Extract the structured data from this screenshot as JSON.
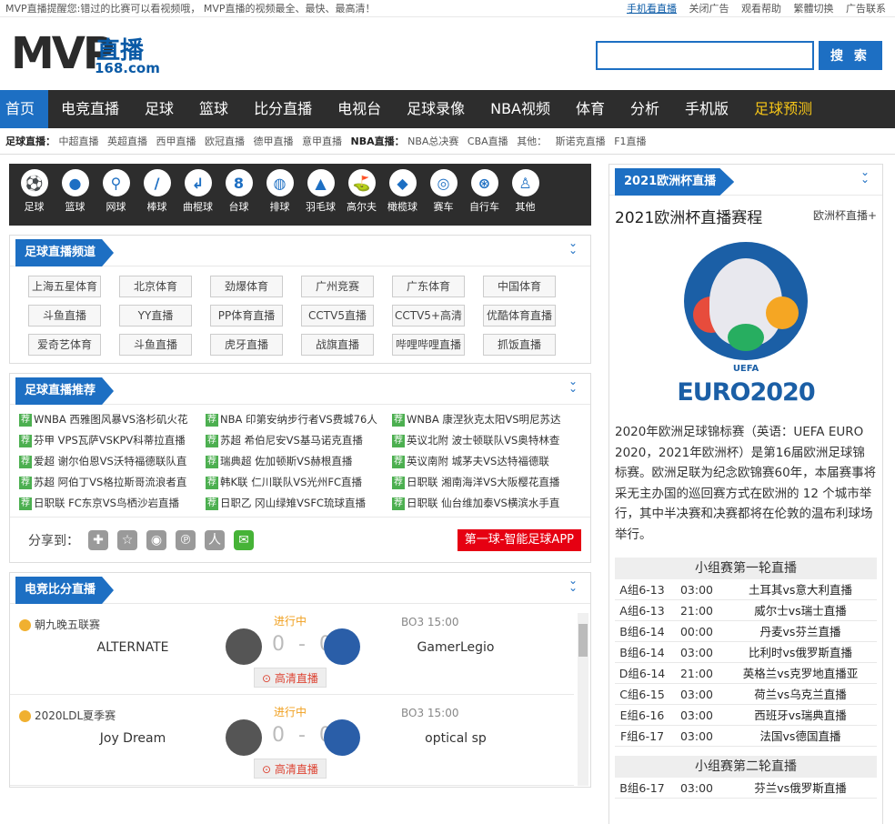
{
  "topbar": {
    "notice": "MVP直播提醒您:错过的比赛可以看视频哦， MVP直播的视频最全、最快、最高清！",
    "links": [
      "手机看直播",
      "关闭广告",
      "观看帮助",
      "繁體切换",
      "广告联系"
    ]
  },
  "logo": {
    "mv": "MVP",
    "zb": "直播",
    "domain": "168.com"
  },
  "search": {
    "button": "搜 索",
    "placeholder": ""
  },
  "nav": [
    "首页",
    "电竞直播",
    "足球",
    "篮球",
    "比分直播",
    "电视台",
    "足球录像",
    "NBA视频",
    "体育",
    "分析",
    "手机版",
    "足球预测"
  ],
  "subnav": {
    "football_label": "足球直播：",
    "football": [
      "中超直播",
      "英超直播",
      "西甲直播",
      "欧冠直播",
      "德甲直播",
      "意甲直播"
    ],
    "nba_label": "NBA直播：",
    "nba": [
      "NBA总决赛",
      "CBA直播"
    ],
    "other_label": "其他：",
    "other": [
      "斯诺克直播",
      "F1直播"
    ]
  },
  "sports": [
    {
      "label": "足球",
      "icon": "soccer-icon",
      "glyph": "⚽"
    },
    {
      "label": "篮球",
      "icon": "basketball-icon",
      "glyph": "●"
    },
    {
      "label": "网球",
      "icon": "tennis-icon",
      "glyph": "⚲"
    },
    {
      "label": "棒球",
      "icon": "baseball-icon",
      "glyph": "/"
    },
    {
      "label": "曲棍球",
      "icon": "hockey-icon",
      "glyph": "↲"
    },
    {
      "label": "台球",
      "icon": "billiards-icon",
      "glyph": "8"
    },
    {
      "label": "排球",
      "icon": "volleyball-icon",
      "glyph": "◍"
    },
    {
      "label": "羽毛球",
      "icon": "badminton-icon",
      "glyph": "▲"
    },
    {
      "label": "高尔夫",
      "icon": "golf-icon",
      "glyph": "⛳"
    },
    {
      "label": "橄榄球",
      "icon": "rugby-icon",
      "glyph": "◆"
    },
    {
      "label": "赛车",
      "icon": "racing-icon",
      "glyph": "◎"
    },
    {
      "label": "自行车",
      "icon": "cycling-icon",
      "glyph": "⊛"
    },
    {
      "label": "其他",
      "icon": "other-icon",
      "glyph": "♙"
    }
  ],
  "channels": {
    "title": "足球直播频道",
    "items": [
      "上海五星体育",
      "北京体育",
      "劲爆体育",
      "广州竞赛",
      "广东体育",
      "中国体育",
      "斗鱼直播",
      "YY直播",
      "PP体育直播",
      "CCTV5直播",
      "CCTV5+高清",
      "优酷体育直播",
      "爱奇艺体育",
      "斗鱼直播",
      "虎牙直播",
      "战旗直播",
      "哔哩哔哩直播",
      "抓饭直播"
    ]
  },
  "recommend": {
    "title": "足球直播推荐",
    "items": [
      "WNBA 西雅图风暴VS洛杉矶火花",
      "NBA 印第安纳步行者VS费城76人",
      "WNBA 康涅狄克太阳VS明尼苏达",
      "芬甲 VPS瓦萨VSKPV科蒂拉直播",
      "苏超 希伯尼安VS基马诺克直播",
      "英议北附 波士顿联队VS奥特林查",
      "爱超 谢尔伯恩VS沃特福德联队直",
      "瑞典超 佐加顿斯VS赫根直播",
      "英议南附 城茅夫VS达特福德联",
      "苏超 阿伯丁VS格拉斯哥流浪者直",
      "韩K联 仁川联队VS光州FC直播",
      "日职联 湘南海洋VS大阪樱花直播",
      "日职联 FC东京VS鸟栖沙岩直播",
      "日职乙 冈山绿雉VSFC琉球直播",
      "日职联 仙台维加泰VS横滨水手直"
    ],
    "tag": "荐"
  },
  "share": {
    "label": "分享到：",
    "app": "第一球-智能足球APP"
  },
  "esports": {
    "title": "电竞比分直播",
    "matches": [
      {
        "league": "朝九晚五联赛",
        "status": "进行中",
        "bo": "BO3 15:00",
        "team1": "ALTERNATE",
        "team2": "GamerLegio",
        "score": "0 - 0",
        "live": "高清直播"
      },
      {
        "league": "2020LDL夏季赛",
        "status": "进行中",
        "bo": "BO3 15:00",
        "team1": "Joy Dream",
        "team2": "optical sp",
        "score": "0 - 0",
        "live": "高清直播"
      }
    ]
  },
  "euro": {
    "tab": "2021欧洲杯直播",
    "title": "2021欧洲杯直播赛程",
    "more": "欧洲杯直播+",
    "uefa": "UEFA",
    "logo_text": "EURO2020",
    "desc": "2020年欧洲足球锦标赛（英语：UEFA EURO 2020，2021年欧洲杯）是第16届欧洲足球锦标赛。欧洲足联为纪念欧锦赛60年，本届赛事将采无主办国的巡回赛方式在欧洲的 12 个城市举行，其中半决赛和决赛都将在伦敦的温布利球场举行。",
    "round1_title": "小组赛第一轮直播",
    "round1": [
      {
        "g": "A组6-13",
        "t": "03:00",
        "m": "土耳其vs意大利直播"
      },
      {
        "g": "A组6-13",
        "t": "21:00",
        "m": "威尔士vs瑞士直播"
      },
      {
        "g": "B组6-14",
        "t": "00:00",
        "m": "丹麦vs芬兰直播"
      },
      {
        "g": "B组6-14",
        "t": "03:00",
        "m": "比利时vs俄罗斯直播"
      },
      {
        "g": "D组6-14",
        "t": "21:00",
        "m": "英格兰vs克罗地直播亚"
      },
      {
        "g": "C组6-15",
        "t": "03:00",
        "m": "荷兰vs乌克兰直播"
      },
      {
        "g": "E组6-16",
        "t": "03:00",
        "m": "西班牙vs瑞典直播"
      },
      {
        "g": "F组6-17",
        "t": "03:00",
        "m": "法国vs德国直播"
      }
    ],
    "round2_title": "小组赛第二轮直播",
    "round2": [
      {
        "g": "B组6-17",
        "t": "03:00",
        "m": "芬兰vs俄罗斯直播"
      }
    ]
  },
  "colors": {
    "brand": "#1d6fc3",
    "nav_bg": "#2d2d2d",
    "highlight": "#f5c518",
    "live_red": "#e60012"
  }
}
